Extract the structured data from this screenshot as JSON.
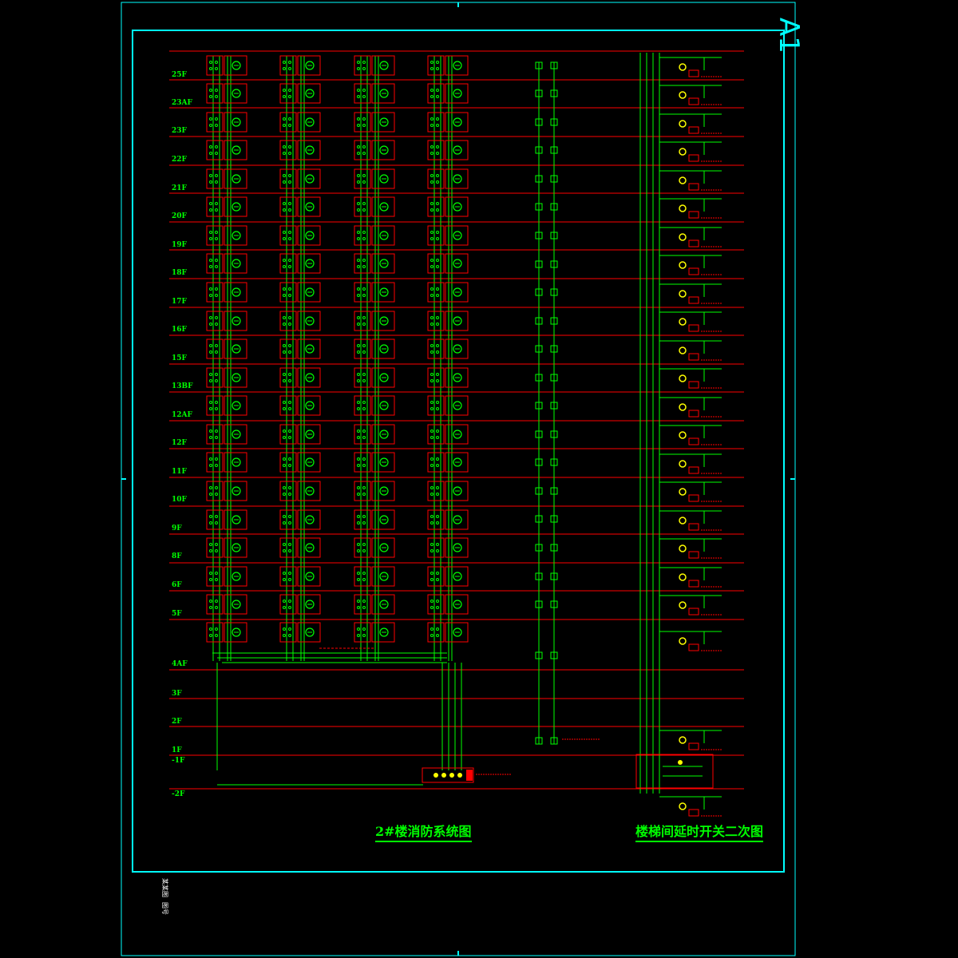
{
  "sheet": {
    "size_label": "A1"
  },
  "floors": [
    "25F",
    "23AF",
    "23F",
    "22F",
    "21F",
    "20F",
    "19F",
    "18F",
    "17F",
    "16F",
    "15F",
    "13BF",
    "12AF",
    "12F",
    "11F",
    "10F",
    "9F",
    "8F",
    "6F",
    "5F",
    "4AF",
    "3F",
    "2F",
    "1F",
    "-1F",
    "-2F"
  ],
  "titles": {
    "fire_system": "2#楼消防系统图",
    "stair_switch": "楼梯间延时开关二次图"
  },
  "title_block": {
    "text_1": "某某图",
    "text_2": "图号"
  },
  "colors": {
    "background": "#000000",
    "frame": "#00ffff",
    "floor_line": "#ff0000",
    "wiring": "#00ff00",
    "labels": "#00ff00",
    "annotation": "#ff0000",
    "device_dot": "#ffff00"
  }
}
